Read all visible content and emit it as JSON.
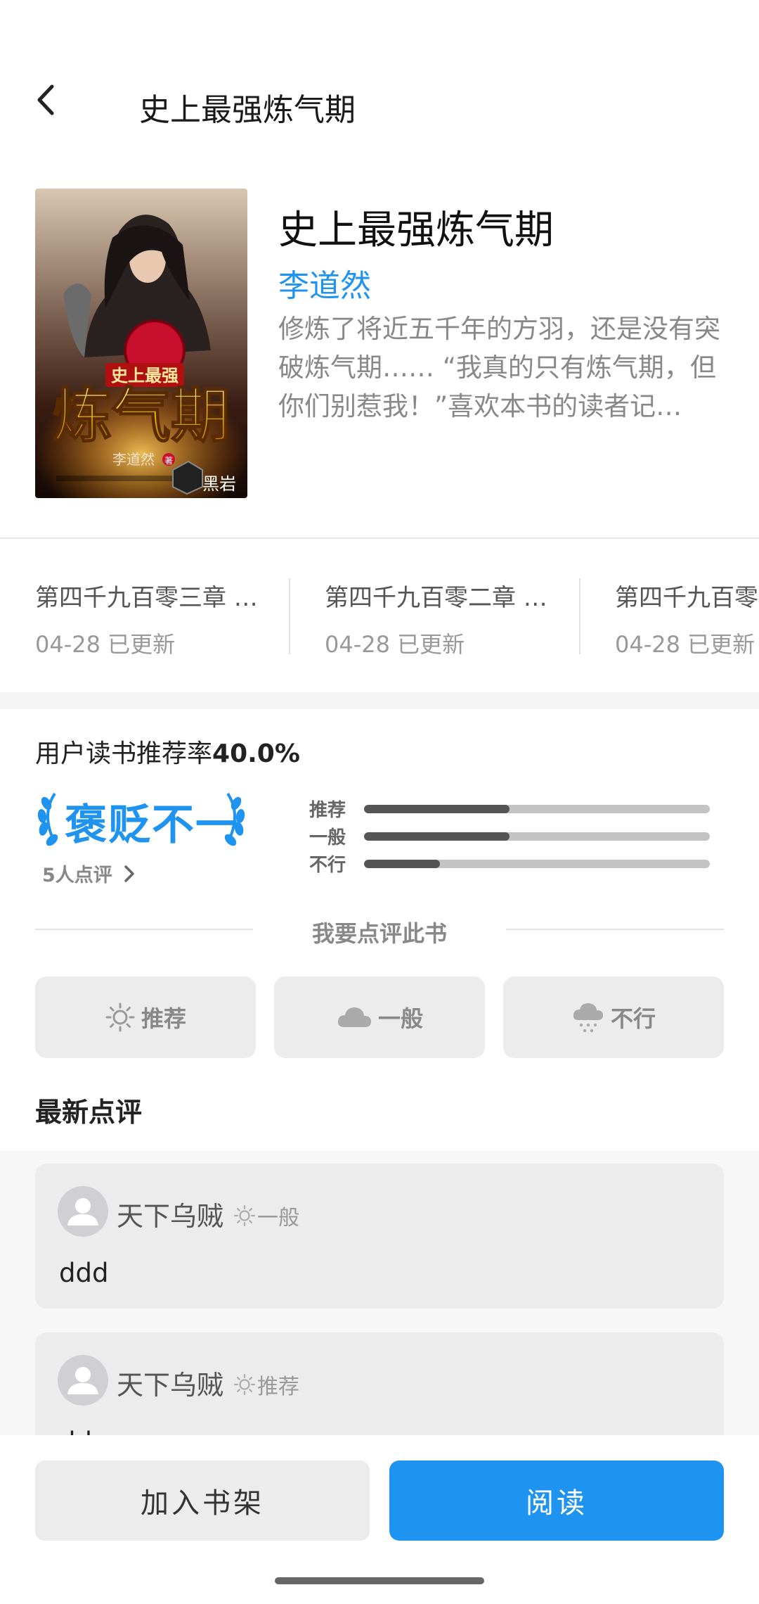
{
  "header": {
    "title": "史上最强炼气期"
  },
  "book": {
    "title": "史上最强炼气期",
    "author": "李道然",
    "intro": "修炼了将近五千年的方羽，还是没有突破炼气期…… “我真的只有炼气期，但你们别惹我！”喜欢本书的读者记…",
    "cover": {
      "banner": "史上最强",
      "title": "炼气期",
      "author": "李道然",
      "author_badge": "著",
      "publisher": "黑岩"
    }
  },
  "chapters": [
    {
      "title": "第四千九百零三章 …",
      "date": "04-28 已更新"
    },
    {
      "title": "第四千九百零二章 …",
      "date": "04-28 已更新"
    },
    {
      "title": "第四千九百零一章",
      "date": "04-28 已更新"
    }
  ],
  "rating": {
    "label": "用户读书推荐率",
    "value": "40.0%",
    "verdict": "褒贬不一",
    "reviewer_count": "5人点评",
    "bars": [
      {
        "label": "推荐",
        "fraction": 0.42
      },
      {
        "label": "一般",
        "fraction": 0.42
      },
      {
        "label": "不行",
        "fraction": 0.22
      }
    ]
  },
  "review_prompt": "我要点评此书",
  "vote_buttons": {
    "recommend": "推荐",
    "average": "一般",
    "bad": "不行"
  },
  "latest_reviews_title": "最新点评",
  "reviews": [
    {
      "user": "天下乌贼",
      "tag": "一般",
      "text": "ddd"
    },
    {
      "user": "天下乌贼",
      "tag": "推荐",
      "text": "dd"
    }
  ],
  "actions": {
    "add_shelf": "加入书架",
    "read": "阅读"
  },
  "colors": {
    "accent": "#1f93f0",
    "bar_fill": "#555555",
    "bar_track": "#c3c3c3"
  }
}
